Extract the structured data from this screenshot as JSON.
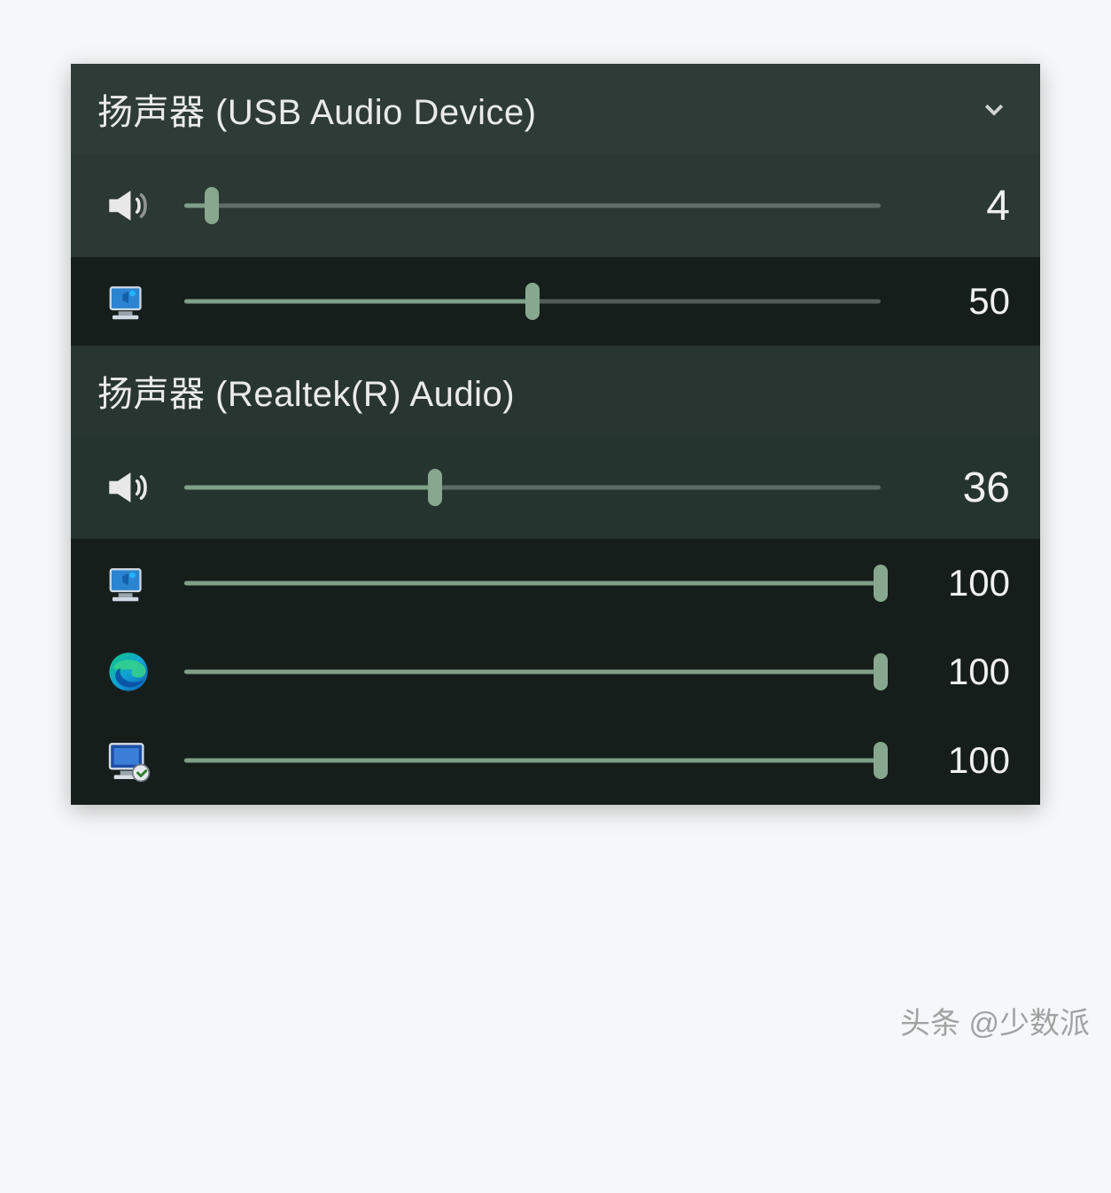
{
  "devices": [
    {
      "label": "扬声器 (USB Audio Device)",
      "expandable": true,
      "master": {
        "icon": "speaker-icon",
        "value": 4
      },
      "apps": [
        {
          "icon": "system-sounds-icon",
          "value": 50
        }
      ]
    },
    {
      "label": "扬声器 (Realtek(R) Audio)",
      "expandable": false,
      "master": {
        "icon": "speaker-icon",
        "value": 36
      },
      "apps": [
        {
          "icon": "system-sounds-icon",
          "value": 100
        },
        {
          "icon": "edge-browser-icon",
          "value": 100
        },
        {
          "icon": "remote-desktop-icon",
          "value": 100
        }
      ]
    }
  ],
  "watermark": "头条 @少数派",
  "colors": {
    "slider_fill": "#7fa089",
    "slider_thumb": "#87a88f",
    "panel_bg": "#1f2a27"
  }
}
